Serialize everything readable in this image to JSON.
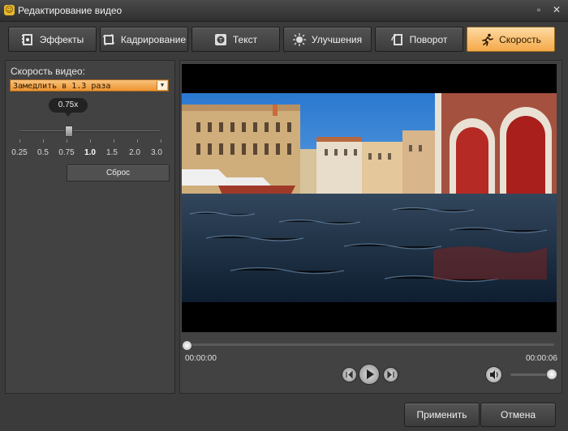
{
  "window": {
    "title": "Редактирование видео",
    "minimize": "▫",
    "close": "✕"
  },
  "tabs": [
    {
      "label": "Эффекты",
      "icon": "film-effects-icon"
    },
    {
      "label": "Кадрирование",
      "icon": "crop-icon"
    },
    {
      "label": "Текст",
      "icon": "text-icon"
    },
    {
      "label": "Улучшения",
      "icon": "brightness-icon"
    },
    {
      "label": "Поворот",
      "icon": "rotate-icon"
    },
    {
      "label": "Скорость",
      "icon": "running-man-icon",
      "active": true
    }
  ],
  "speed_panel": {
    "label": "Скорость видео:",
    "select_value": "Замедлить в 1.3 раза",
    "tooltip": "0.75x",
    "slider_value": 0.75,
    "ticks": [
      "0.25",
      "0.5",
      "0.75",
      "1.0",
      "1.5",
      "2.0",
      "3.0"
    ],
    "bold_tick": "1.0",
    "reset_label": "Сброс"
  },
  "player": {
    "current_time": "00:00:00",
    "total_time": "00:00:06",
    "position": 0,
    "volume": 1.0
  },
  "buttons": {
    "apply": "Применить",
    "cancel": "Отмена"
  },
  "colors": {
    "accent": "#f4a949",
    "background": "#3b3b3b"
  }
}
